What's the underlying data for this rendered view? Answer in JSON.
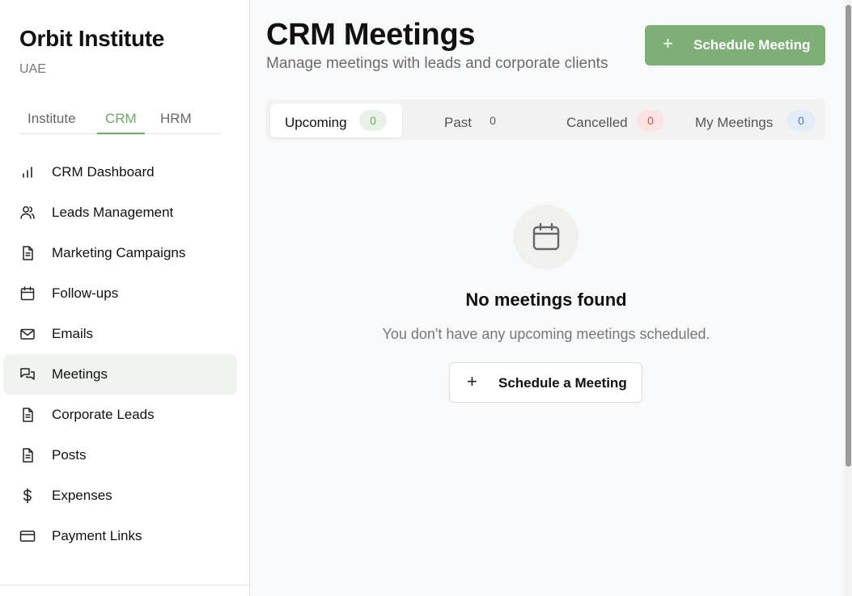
{
  "sidebar": {
    "brand": "Orbit Institute",
    "region": "UAE",
    "tabs": [
      {
        "label": "Institute"
      },
      {
        "label": "CRM"
      },
      {
        "label": "HRM"
      }
    ],
    "active_tab": "CRM",
    "items": [
      {
        "label": "CRM Dashboard",
        "icon": "bar-chart-icon"
      },
      {
        "label": "Leads Management",
        "icon": "users-icon"
      },
      {
        "label": "Marketing Campaigns",
        "icon": "document-icon"
      },
      {
        "label": "Follow-ups",
        "icon": "calendar-icon"
      },
      {
        "label": "Emails",
        "icon": "mail-icon"
      },
      {
        "label": "Meetings",
        "icon": "chat-bubbles-icon"
      },
      {
        "label": "Corporate Leads",
        "icon": "document-icon"
      },
      {
        "label": "Posts",
        "icon": "document-icon"
      },
      {
        "label": "Expenses",
        "icon": "dollar-icon"
      },
      {
        "label": "Payment Links",
        "icon": "credit-card-icon"
      }
    ],
    "active_item": "Meetings"
  },
  "header": {
    "title": "CRM Meetings",
    "subtitle": "Manage meetings with leads and corporate clients",
    "primary_button": "Schedule Meeting"
  },
  "tabs": [
    {
      "label": "Upcoming",
      "count": "0",
      "badge_bg": "#e8f2e6",
      "badge_fg": "#6fa86a"
    },
    {
      "label": "Past",
      "count": "0",
      "badge_bg": "transparent",
      "badge_fg": "#555555"
    },
    {
      "label": "Cancelled",
      "count": "0",
      "badge_bg": "#fbe3e3",
      "badge_fg": "#d9534f"
    },
    {
      "label": "My Meetings",
      "count": "0",
      "badge_bg": "#e3ecf9",
      "badge_fg": "#4a78c2"
    }
  ],
  "active_tab": "Upcoming",
  "empty_state": {
    "icon": "calendar-icon",
    "title": "No meetings found",
    "message": "You don't have any upcoming meetings scheduled.",
    "button": "Schedule a Meeting"
  },
  "colors": {
    "accent": "#7daf77",
    "active_nav_bg": "#eff4ee"
  }
}
